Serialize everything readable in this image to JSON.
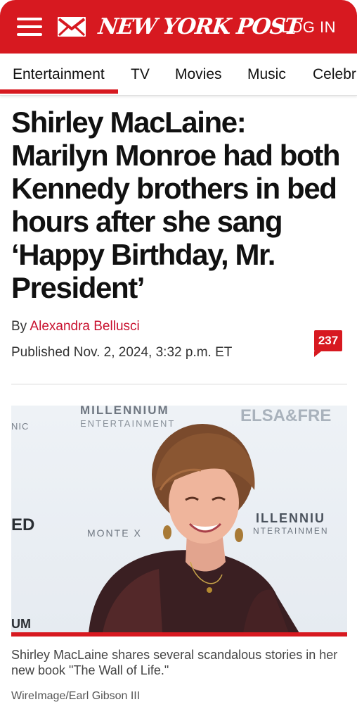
{
  "header": {
    "logo_text": "NEW YORK POST",
    "login_label": "LOG IN",
    "brand_color": "#d71920",
    "menu_icon": "hamburger-menu-icon",
    "mail_icon": "envelope-icon"
  },
  "nav": {
    "tabs": [
      "Entertainment",
      "TV",
      "Movies",
      "Music",
      "Celebri"
    ],
    "active_index": 0
  },
  "article": {
    "headline": "Shirley MacLaine: Marilyn Monroe had both Kennedy brothers in bed hours after she sang ‘Happy Birthday, Mr. President’",
    "byline_prefix": "By",
    "author": "Alexandra Bellusci",
    "published": "Published Nov. 2, 2024, 3:32 p.m. ET",
    "comment_count": "237"
  },
  "photo": {
    "backdrop_text": {
      "millennium": "MILLENNIUM",
      "entertainment": "ENTERTAINMENT",
      "elsa": "ELSA&FRE",
      "nic": "NIC",
      "ed": "ED",
      "monte": "MONTE X",
      "millenniu_right": "ILLENNIU",
      "entertainmen_right": "NTERTAINMEN",
      "um": "UM"
    },
    "caption": "Shirley MacLaine shares several scandalous stories in her new book \"The Wall of Life.\"",
    "credit": "WireImage/Earl Gibson III"
  }
}
